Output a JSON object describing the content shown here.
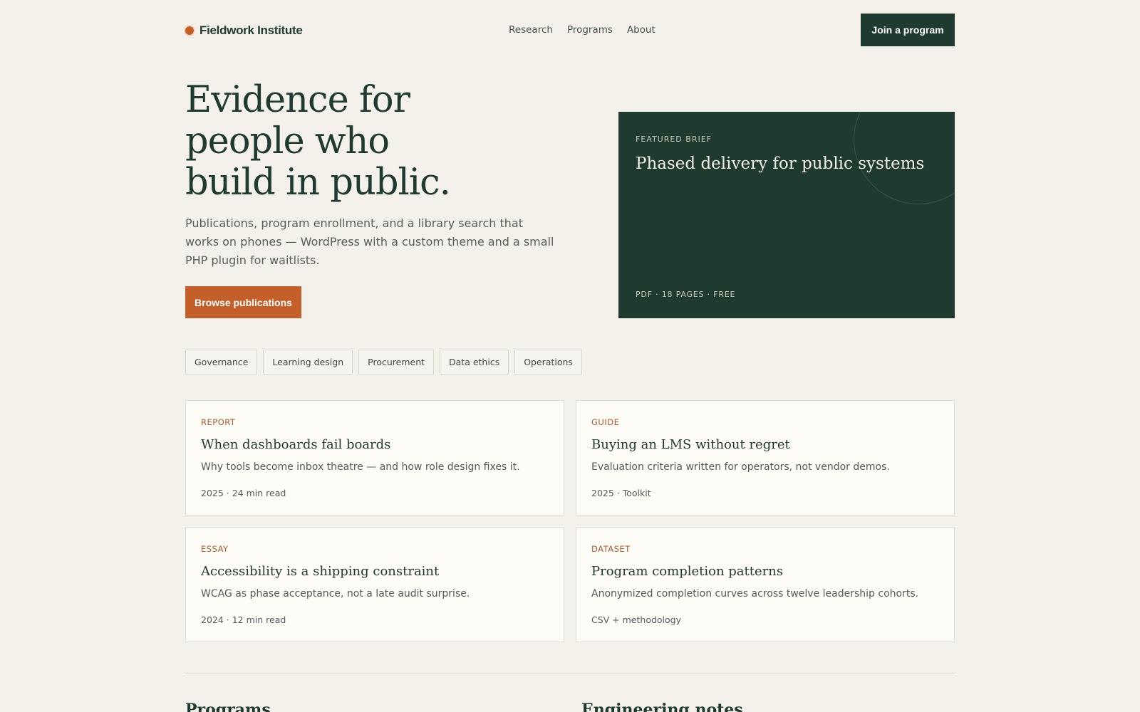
{
  "header": {
    "brand_name": "Fieldwork Institute",
    "nav": [
      "Research",
      "Programs",
      "About"
    ],
    "cta_label": "Join a program"
  },
  "hero": {
    "title_lines": [
      "Evidence for",
      "people who",
      "build in public."
    ],
    "description": "Publications, program enrollment, and a library search that works on phones — WordPress with a custom theme and a small PHP plugin for waitlists.",
    "button_label": "Browse publications"
  },
  "featured": {
    "kicker": "FEATURED BRIEF",
    "title": "Phased delivery for public systems",
    "meta": "PDF · 18 PAGES · FREE"
  },
  "topics": [
    "Governance",
    "Learning design",
    "Procurement",
    "Data ethics",
    "Operations"
  ],
  "cards": [
    {
      "kicker": "REPORT",
      "title": "When dashboards fail boards",
      "desc": "Why tools become inbox theatre — and how role design fixes it.",
      "meta": "2025 · 24 min read"
    },
    {
      "kicker": "GUIDE",
      "title": "Buying an LMS without regret",
      "desc": "Evaluation criteria written for operators, not vendor demos.",
      "meta": "2025 · Toolkit"
    },
    {
      "kicker": "ESSAY",
      "title": "Accessibility is a shipping constraint",
      "desc": "WCAG as phase acceptance, not a late audit surprise.",
      "meta": "2024 · 12 min read"
    },
    {
      "kicker": "DATASET",
      "title": "Program completion patterns",
      "desc": "Anonymized completion curves across twelve leadership cohorts.",
      "meta": "CSV + methodology"
    }
  ],
  "bottom": {
    "programs_heading": "Programs",
    "engineering_heading": "Engineering notes"
  },
  "colors": {
    "background": "#f3f1ea",
    "primary_green": "#1f3a2e",
    "accent_orange": "#c45f2a",
    "card_bg": "#fdfcf7"
  },
  "icons": {
    "brand_mark": "brand-dot-icon"
  }
}
